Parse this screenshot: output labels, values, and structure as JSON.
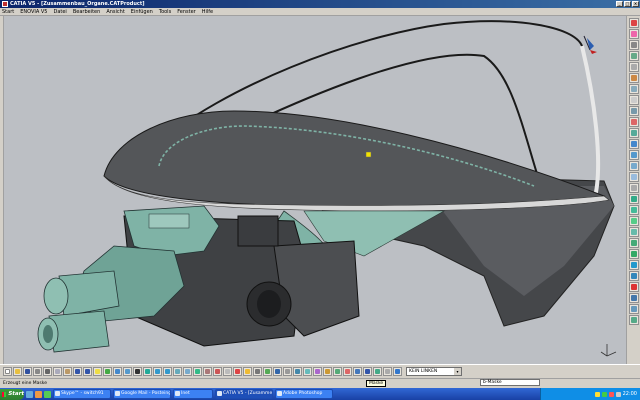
{
  "window": {
    "title": "CATIA V5 - [Zusammenbau_Organe.CATProduct]",
    "minimize": "_",
    "maximize": "□",
    "close": "×"
  },
  "menu": [
    "Start",
    "ENOVIA V5",
    "Datei",
    "Bearbeiten",
    "Ansicht",
    "Einfügen",
    "Tools",
    "Fenster",
    "Hilfe"
  ],
  "toolbar": {
    "combo_value": "KEIN LINKEN",
    "combo_arrow": "▾"
  },
  "status": {
    "message": "Erzeugt eine Maske",
    "tooltip": "Maske",
    "field_label": "b-Maske"
  },
  "taskbar": {
    "start": "Start",
    "tasks": [
      {
        "label": "Skype™ - switch91",
        "active": false
      },
      {
        "label": "Google Mail - Posteingan...",
        "active": false
      },
      {
        "label": "Inet",
        "active": false
      },
      {
        "label": "CATIA V5 - [Zusammenb...",
        "active": true
      },
      {
        "label": "Adobe Photoshop",
        "active": false
      }
    ],
    "clock": "22:00"
  },
  "colors": {
    "viewport_bg": "#bcbfc4",
    "body_dark": "#4a4c4f",
    "body_mid": "#6b6e72",
    "highlight_teal": "#7fb3a6",
    "edge_light": "#e8e8e8"
  },
  "icons": {
    "right_toolbar": [
      "tree-icon",
      "sketch-icon",
      "pad-icon",
      "pocket-icon",
      "shaft-icon",
      "groove-icon",
      "hole-icon",
      "rib-icon",
      "slot-icon",
      "fillet-icon",
      "chamfer-icon",
      "draft-icon",
      "shell-icon",
      "thickness-icon",
      "thread-icon",
      "split-icon",
      "sew-icon",
      "translate-icon",
      "rotate-icon",
      "symmetry-icon",
      "pattern-icon",
      "scale-icon",
      "boolean-icon",
      "constraint-icon",
      "measure-icon",
      "analysis-icon",
      "material-icon",
      "plane-icon",
      "point-icon",
      "line-icon"
    ],
    "bottom_toolbar": [
      "new-icon",
      "open-icon",
      "save-icon",
      "print-icon",
      "cut-icon",
      "copy-icon",
      "paste-icon",
      "undo-icon",
      "redo-icon",
      "whatsthis-icon",
      "update-icon",
      "fly-icon",
      "fit-icon",
      "pan-icon",
      "rotate-view-icon",
      "zoom-in-icon",
      "zoom-out-icon",
      "normal-view-icon",
      "iso-view-icon",
      "shading-icon",
      "hide-icon",
      "swap-icon",
      "layer-icon",
      "measure-icon",
      "light-icon",
      "camera-icon",
      "snap-icon",
      "axis-icon",
      "grid-icon",
      "filter-icon"
    ]
  }
}
